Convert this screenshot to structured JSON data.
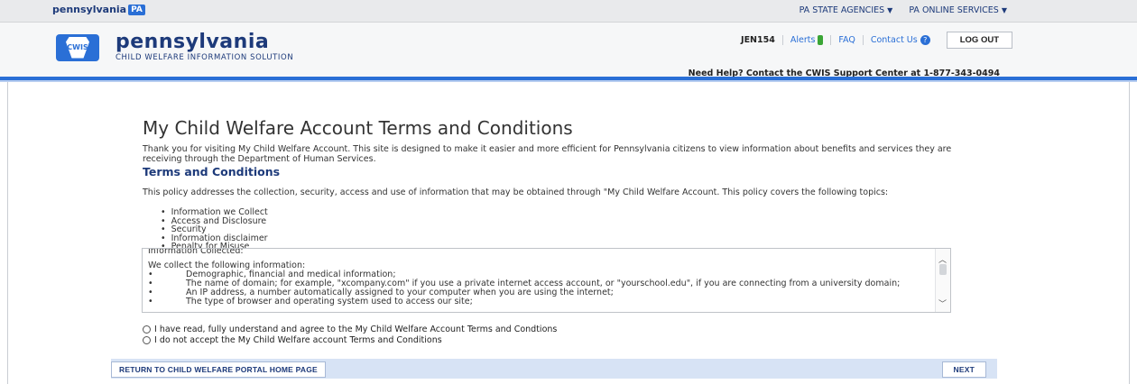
{
  "topbar": {
    "logo_word": "pennsylvania",
    "logo_badge": "PA",
    "menus": [
      {
        "label": "PA STATE AGENCIES"
      },
      {
        "label": "PA ONLINE SERVICES"
      }
    ]
  },
  "header": {
    "brand_title": "pennsylvania",
    "brand_sub": "CHILD WELFARE INFORMATION SOLUTION",
    "keystone_text": "CWIS",
    "user": "JEN154",
    "alerts": "Alerts",
    "faq": "FAQ",
    "contact": "Contact Us",
    "logout": "LOG OUT",
    "help_line": "Need Help? Contact the CWIS Support Center at 1-877-343-0494"
  },
  "main": {
    "title": "My Child Welfare Account Terms and Conditions",
    "intro": "Thank you for visiting My Child Welfare Account. This site is designed to make it easier and more efficient for Pennsylvania citizens to view information about benefits and services they are receiving through the Department of Human Services.",
    "section_heading": "Terms and Conditions",
    "policy": "This policy addresses the collection, security, access and use of information that may be obtained through \"My Child Welfare Account. This policy covers the following topics:",
    "topics": [
      "Information we Collect",
      "Access and Disclosure",
      "Security",
      "Information disclaimer",
      "Penalty for Misuse"
    ],
    "terms_box": {
      "heading": "Information Collected:",
      "lead": "We collect the following information:",
      "items": [
        "Demographic, financial and medical information;",
        "The name of domain; for example, \"xcompany.com\" if you use a private internet access account, or \"yourschool.edu\", if you are connecting from a university domain;",
        "An IP address, a number automatically assigned to your computer when you are using the internet;",
        "The type of browser and operating system used to access our site;"
      ]
    },
    "radio_accept": "I have read, fully understand and agree to the My Child Welfare Account Terms and Condtions",
    "radio_decline": "I do not accept the My Child Welfare account Terms and Conditions"
  },
  "footer": {
    "return_label": "RETURN TO CHILD WELFARE PORTAL HOME PAGE",
    "next_label": "NEXT"
  },
  "colors": {
    "brand_blue": "#1d3a7a",
    "accent_blue": "#2a6fd6",
    "alert_green": "#3aa535"
  }
}
